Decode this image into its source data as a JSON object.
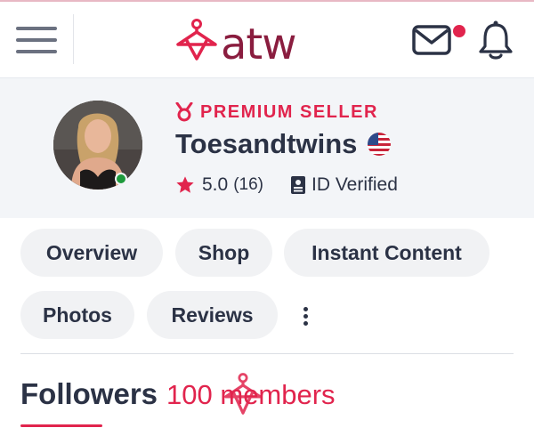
{
  "header": {
    "logo_text": "atw",
    "menu_icon": "hamburger-menu-icon",
    "mail_icon": "envelope-icon",
    "notification_icon": "bell-icon",
    "has_unread_mail": true
  },
  "profile": {
    "badge_label": "PREMIUM SELLER",
    "badge_icon": "medal-icon",
    "username": "Toesandtwins",
    "country_flag": "us-flag-icon",
    "online": true,
    "rating": "5.0",
    "review_count": "(16)",
    "id_status": "ID Verified"
  },
  "tabs": [
    {
      "label": "Overview"
    },
    {
      "label": "Shop"
    },
    {
      "label": "Instant Content"
    },
    {
      "label": "Photos"
    },
    {
      "label": "Reviews"
    }
  ],
  "section": {
    "title": "Followers",
    "count_text": "100 members"
  },
  "colors": {
    "accent": "#e1244d",
    "brand": "#8a1d3f",
    "text": "#2b3245",
    "online": "#1e9a3c"
  }
}
